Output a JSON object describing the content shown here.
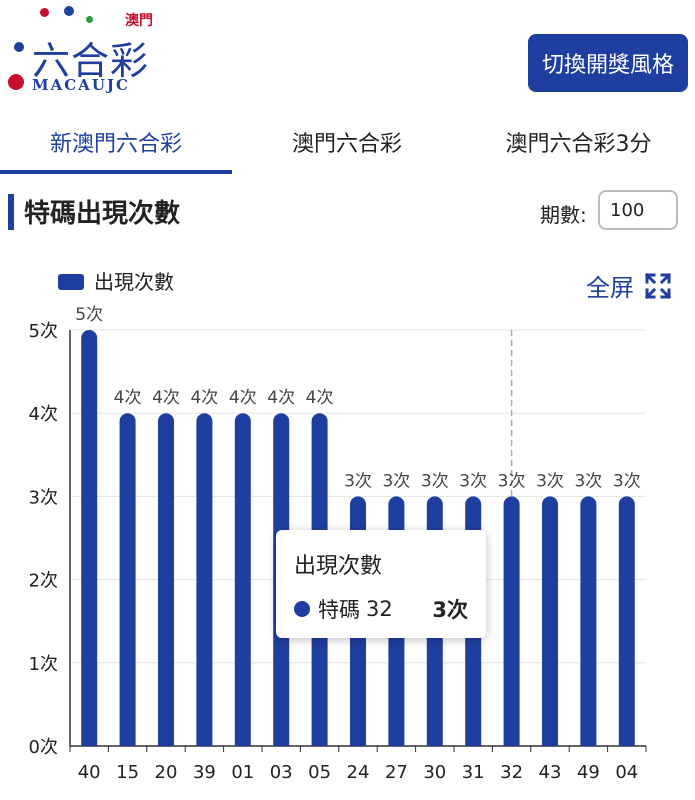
{
  "header": {
    "logo_main": "六合彩",
    "logo_small": "澳門",
    "logo_sub": "MACAUJC",
    "switch_button": "切換開獎風格"
  },
  "tabs": [
    {
      "label": "新澳門六合彩",
      "active": true
    },
    {
      "label": "澳門六合彩",
      "active": false
    },
    {
      "label": "澳門六合彩3分",
      "active": false
    }
  ],
  "section": {
    "title": "特碼出現次數",
    "period_label": "期數:",
    "period_value": "100"
  },
  "fullscreen": {
    "label": "全屏",
    "icon": "fullscreen-icon"
  },
  "colors": {
    "accent": "#1f3fa0",
    "bar": "#1f3fa0",
    "grid": "#e6e6e6"
  },
  "chart_data": {
    "type": "bar",
    "legend": "出現次數",
    "legend_position": "top-left",
    "categories": [
      "40",
      "15",
      "20",
      "39",
      "01",
      "03",
      "05",
      "24",
      "27",
      "30",
      "31",
      "32",
      "43",
      "49",
      "04"
    ],
    "values": [
      5,
      4,
      4,
      4,
      4,
      4,
      4,
      3,
      3,
      3,
      3,
      3,
      3,
      3,
      3
    ],
    "data_labels": [
      "5次",
      "4次",
      "4次",
      "4次",
      "4次",
      "4次",
      "4次",
      "3次",
      "3次",
      "3次",
      "3次",
      "3次",
      "3次",
      "3次",
      "3次"
    ],
    "y_ticks": [
      "0次",
      "1次",
      "2次",
      "3次",
      "4次",
      "5次"
    ],
    "ylim": [
      0,
      5
    ],
    "grid": true,
    "highlight_index": 11
  },
  "tooltip": {
    "title": "出現次數",
    "label": "特碼",
    "number": "32",
    "value": "3次"
  }
}
